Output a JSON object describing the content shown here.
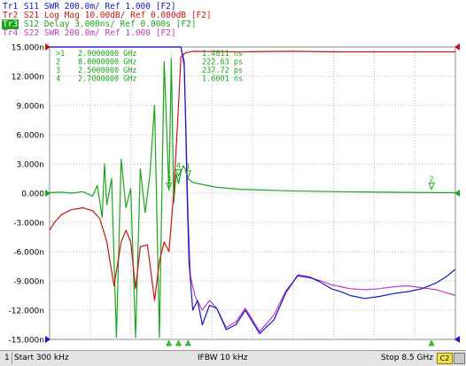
{
  "traces": [
    {
      "label": "Tr1",
      "param": "S11",
      "format": "SWR",
      "scale": "200.0m/",
      "ref": "Ref 1.000",
      "tag": "[F2]",
      "color": "#1515c6",
      "active": false
    },
    {
      "label": "Tr2",
      "param": "S21",
      "format": "Log Mag",
      "scale": "10.00dB/",
      "ref": "Ref 0.000dB",
      "tag": "[F2]",
      "color": "#c81414",
      "active": false
    },
    {
      "label": "Tr3",
      "param": "S12",
      "format": "Delay",
      "scale": "3.000ns/",
      "ref": "Ref 0.000s",
      "tag": "[F2]",
      "color": "#1aa61a",
      "active": true
    },
    {
      "label": "Tr4",
      "param": "S22",
      "format": "SWR",
      "scale": "200.0m/",
      "ref": "Ref 1.000",
      "tag": "[F2]",
      "color": "#c43cc4",
      "active": false
    }
  ],
  "y_axis": {
    "labels": [
      "15.000n",
      "12.000n",
      "9.000n",
      "6.000n",
      "3.000n",
      "0.000",
      "-3.000n",
      "-6.000n",
      "-9.000n",
      "-12.000n",
      "-15.000n"
    ]
  },
  "marker_table": [
    {
      "id": ">1",
      "freq": "2.9000000 GHz",
      "value": "1.4811 ns"
    },
    {
      "id": "2",
      "freq": "8.0000000 GHz",
      "value": "222.63 ps"
    },
    {
      "id": "3",
      "freq": "2.5000000 GHz",
      "value": "237.72 ps"
    },
    {
      "id": "4",
      "freq": "2.7000000 GHz",
      "value": "1.6001 ns"
    }
  ],
  "marker_table_color": "#1aa61a",
  "chart_data": {
    "type": "line",
    "x_range_ghz": [
      0.0003,
      8.5
    ],
    "ylim": [
      -15,
      15
    ],
    "y_unit": "ns",
    "grid": true,
    "series": [
      {
        "name": "S11",
        "color": "#1515c6",
        "x": [
          0.0003,
          2.75,
          2.82,
          2.85,
          2.88,
          2.92,
          3.0,
          3.1,
          3.2,
          3.35,
          3.5,
          3.7,
          3.9,
          4.1,
          4.4,
          4.7,
          4.95,
          5.2,
          5.45,
          5.7,
          5.9,
          6.1,
          6.3,
          6.6,
          6.9,
          7.2,
          7.5,
          7.8,
          8.1,
          8.3,
          8.5
        ],
        "y": [
          15.0,
          15.0,
          13.5,
          7.0,
          0.0,
          -7.0,
          -12.0,
          -11.0,
          -13.5,
          -11.5,
          -11.8,
          -14.0,
          -13.5,
          -12.0,
          -14.4,
          -13.0,
          -10.2,
          -8.4,
          -8.6,
          -9.2,
          -9.8,
          -10.1,
          -10.5,
          -10.8,
          -10.6,
          -10.3,
          -10.1,
          -9.8,
          -9.2,
          -8.6,
          -7.8
        ]
      },
      {
        "name": "S21",
        "color": "#c81414",
        "x": [
          0.0003,
          0.1,
          0.25,
          0.45,
          0.7,
          0.9,
          1.05,
          1.2,
          1.35,
          1.5,
          1.6,
          1.7,
          1.8,
          1.9,
          2.05,
          2.2,
          2.3,
          2.4,
          2.5,
          2.6,
          2.7,
          2.75,
          2.85,
          3.0,
          4.0,
          5.0,
          6.0,
          7.0,
          8.0,
          8.5
        ],
        "y": [
          -3.8,
          -3.0,
          -2.2,
          -1.7,
          -1.5,
          -1.8,
          -2.6,
          -5.0,
          -9.5,
          -5.0,
          -3.8,
          -5.0,
          -9.8,
          -5.5,
          -5.3,
          -11.0,
          -7.0,
          -5.0,
          -6.0,
          0.0,
          9.0,
          14.0,
          14.4,
          14.55,
          14.5,
          14.55,
          14.5,
          14.5,
          14.5,
          14.5
        ]
      },
      {
        "name": "S12",
        "color": "#1aa61a",
        "x": [
          0.0003,
          0.25,
          0.45,
          0.7,
          0.9,
          1.0,
          1.1,
          1.15,
          1.2,
          1.3,
          1.4,
          1.5,
          1.6,
          1.7,
          1.8,
          1.9,
          2.0,
          2.1,
          2.2,
          2.3,
          2.4,
          2.5,
          2.55,
          2.6,
          2.65,
          2.7,
          2.75,
          2.8,
          2.85,
          2.9,
          3.0,
          3.2,
          3.5,
          4.0,
          5.0,
          6.0,
          7.0,
          8.0,
          8.5
        ],
        "y": [
          0.05,
          0.1,
          0.0,
          0.15,
          -0.3,
          0.8,
          -2.5,
          3.0,
          -1.2,
          1.5,
          -14.8,
          3.5,
          -1.5,
          0.5,
          -14.8,
          2.5,
          -2.0,
          1.8,
          9.0,
          -14.8,
          13.5,
          0.3,
          13.8,
          -1.0,
          2.0,
          1.0,
          2.2,
          2.8,
          2.4,
          1.5,
          1.1,
          0.9,
          0.6,
          0.4,
          0.25,
          0.15,
          0.1,
          0.05,
          0.05
        ]
      },
      {
        "name": "S22",
        "color": "#c43cc4",
        "x": [
          0.0003,
          2.75,
          2.82,
          2.86,
          2.9,
          2.95,
          3.05,
          3.2,
          3.35,
          3.5,
          3.7,
          3.9,
          4.1,
          4.4,
          4.7,
          4.95,
          5.2,
          5.45,
          5.7,
          5.9,
          6.1,
          6.3,
          6.6,
          6.9,
          7.2,
          7.5,
          7.8,
          8.1,
          8.3,
          8.5
        ],
        "y": [
          15.0,
          15.0,
          13.0,
          6.0,
          -2.0,
          -8.5,
          -10.6,
          -12.0,
          -11.0,
          -11.8,
          -13.8,
          -13.2,
          -11.8,
          -14.2,
          -12.5,
          -10.0,
          -8.5,
          -8.7,
          -9.0,
          -9.4,
          -9.6,
          -9.8,
          -9.9,
          -9.8,
          -9.6,
          -9.5,
          -9.7,
          -9.9,
          -10.2,
          -10.5
        ]
      }
    ],
    "markers": [
      {
        "trace": "S12",
        "id": "1",
        "x_ghz": 2.9,
        "y": 1.4811
      },
      {
        "trace": "S12",
        "id": "2",
        "x_ghz": 8.0,
        "y": 0.22263
      },
      {
        "trace": "S12",
        "id": "3",
        "x_ghz": 2.5,
        "y": 0.23772
      },
      {
        "trace": "S12",
        "id": "4",
        "x_ghz": 2.7,
        "y": 1.6001
      }
    ]
  },
  "status_bar": {
    "channel": "1",
    "start": "Start 300 kHz",
    "ifbw": "IFBW 10 kHz",
    "stop": "Stop 8.5 GHz",
    "channel_badge": "C2"
  }
}
